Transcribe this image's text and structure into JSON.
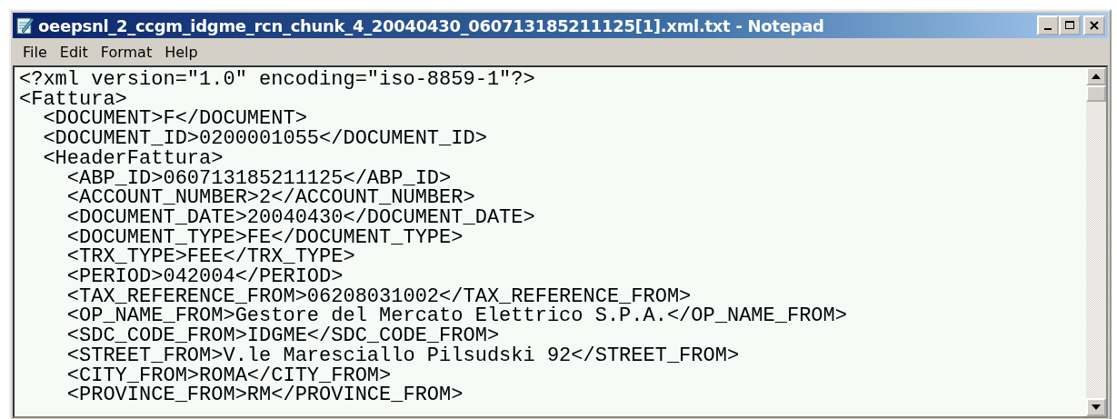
{
  "window": {
    "title": "oeepsnl_2_ccgm_idgme_rcn_chunk_4_20040430_060713185211125[1].xml.txt - Notepad"
  },
  "menu": [
    "File",
    "Edit",
    "Format",
    "Help"
  ],
  "editor": {
    "lines": [
      "<?xml version=\"1.0\" encoding=\"iso-8859-1\"?>",
      "<Fattura>",
      "  <DOCUMENT>F</DOCUMENT>",
      "  <DOCUMENT_ID>0200001055</DOCUMENT_ID>",
      "  <HeaderFattura>",
      "    <ABP_ID>060713185211125</ABP_ID>",
      "    <ACCOUNT_NUMBER>2</ACCOUNT_NUMBER>",
      "    <DOCUMENT_DATE>20040430</DOCUMENT_DATE>",
      "    <DOCUMENT_TYPE>FE</DOCUMENT_TYPE>",
      "    <TRX_TYPE>FEE</TRX_TYPE>",
      "    <PERIOD>042004</PERIOD>",
      "    <TAX_REFERENCE_FROM>06208031002</TAX_REFERENCE_FROM>",
      "    <OP_NAME_FROM>Gestore del Mercato Elettrico S.P.A.</OP_NAME_FROM>",
      "    <SDC_CODE_FROM>IDGME</SDC_CODE_FROM>",
      "    <STREET_FROM>V.le Maresciallo Pilsudski 92</STREET_FROM>",
      "    <CITY_FROM>ROMA</CITY_FROM>",
      "    <PROVINCE_FROM>RM</PROVINCE_FROM>"
    ]
  }
}
